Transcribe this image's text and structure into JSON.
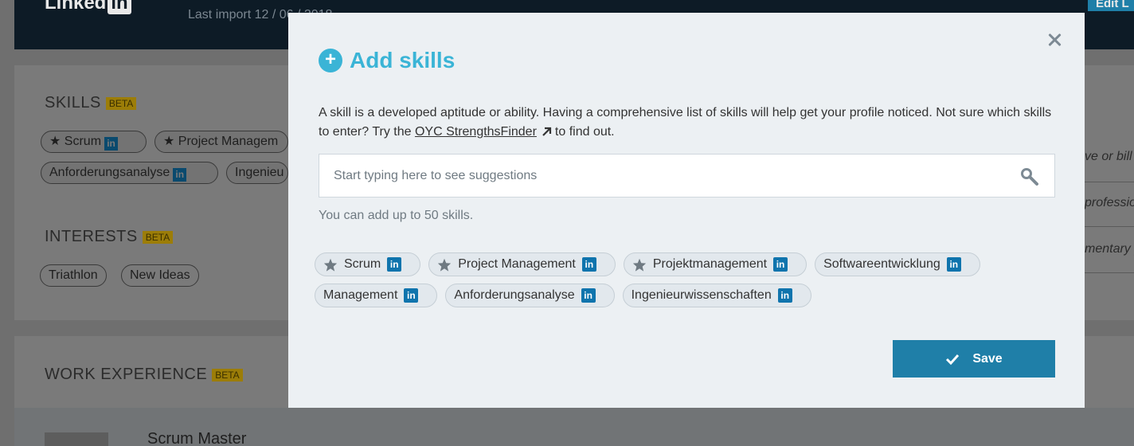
{
  "background": {
    "logo_text": "Linked",
    "logo_in": "in",
    "last_import": "Last import 12 / 06 / 2018",
    "edit_label": "Edit L",
    "skills_title": "SKILLS",
    "interests_title": "INTERESTS",
    "work_title": "WORK EXPERIENCE",
    "beta_label": "BETA",
    "skill_tags": [
      "Scrum",
      "Project Managem",
      "Anforderungsanalyse",
      "Ingenieu"
    ],
    "interest_tags": [
      "Triathlon",
      "New Ideas"
    ],
    "right_snippets": [
      "ve or bill",
      "professio",
      "mentary p"
    ],
    "role_title": "Scrum Master"
  },
  "modal": {
    "title": "Add skills",
    "description_before_link": "A skill is a developed aptitude or ability. Having a comprehensive list of skills will help get your profile noticed. Not sure which skills to enter? Try the ",
    "link_text": "OYC StrengthsFinder",
    "description_after_link": "to find out.",
    "search_placeholder": "Start typing here to see suggestions",
    "search_value": "",
    "hint": "You can add up to 50 skills.",
    "li_label": "in",
    "tags_row1": [
      {
        "label": "Scrum",
        "starred": true
      },
      {
        "label": "Project Management",
        "starred": true
      },
      {
        "label": "Projektmanagement",
        "starred": true
      },
      {
        "label": "Softwareentwicklung",
        "starred": false
      }
    ],
    "tags_row2": [
      {
        "label": "Management",
        "starred": false
      },
      {
        "label": "Anforderungsanalyse",
        "starred": false
      },
      {
        "label": "Ingenieurwissenschaften",
        "starred": false
      }
    ],
    "save_label": "Save"
  },
  "colors": {
    "accent": "#3ab4d6",
    "primary_button": "#1f7fa8",
    "linkedin_blue": "#0f74ad",
    "overlay": "#6f6f6f"
  },
  "icons": [
    "plus-icon",
    "close-icon",
    "external-link-icon",
    "search-icon",
    "star-icon",
    "linkedin-icon",
    "check-icon"
  ]
}
